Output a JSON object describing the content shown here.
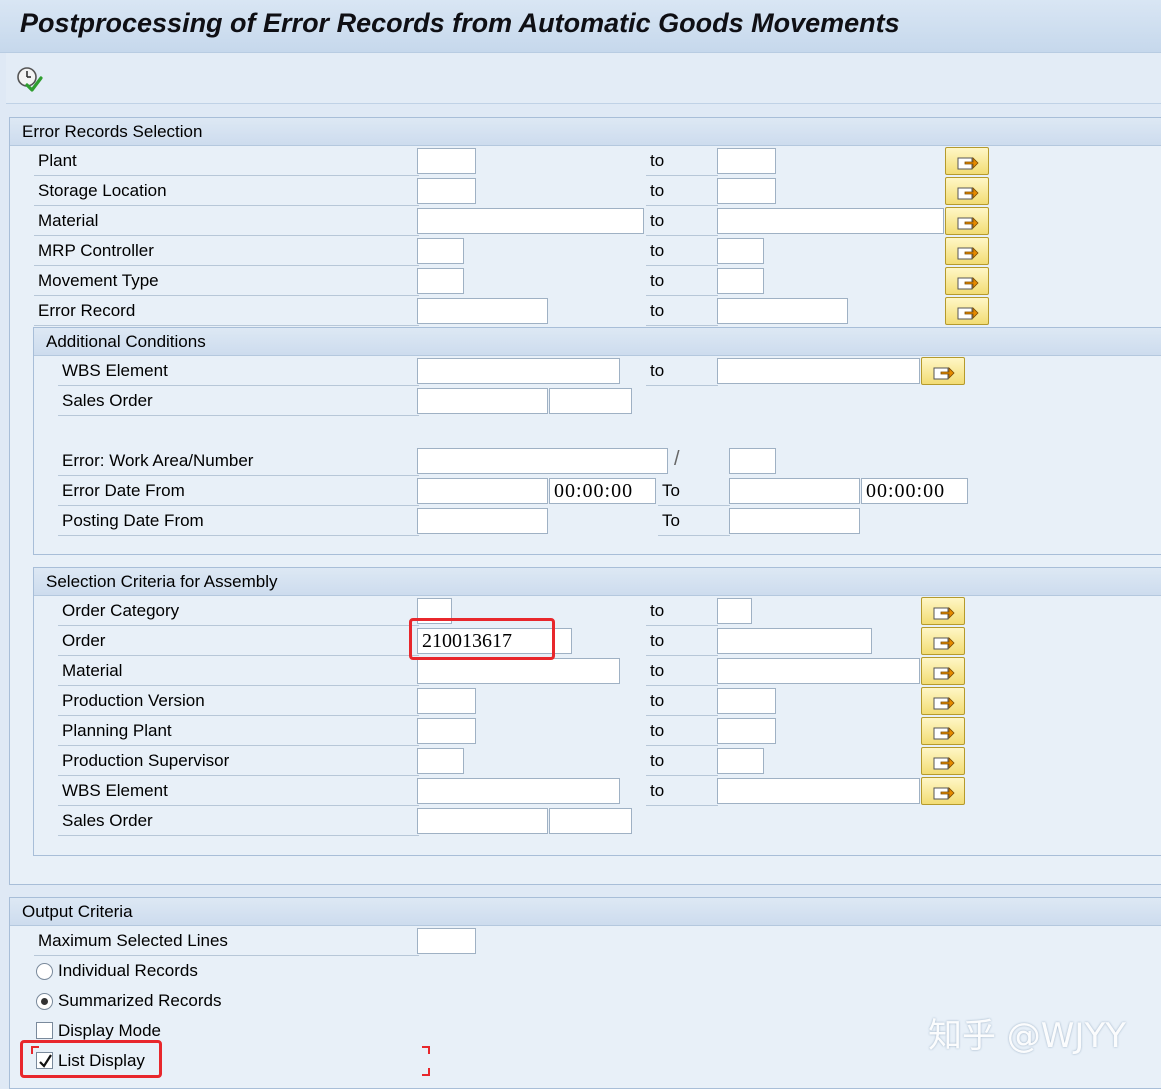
{
  "window": {
    "title": "Postprocessing of Error Records from Automatic Goods Movements"
  },
  "toolbar": {
    "execute_icon": "clock-check-icon"
  },
  "error_records_selection": {
    "header": "Error Records Selection",
    "to_label": "to",
    "rows": [
      {
        "label": "Plant",
        "from": "",
        "to": ""
      },
      {
        "label": "Storage Location",
        "from": "",
        "to": ""
      },
      {
        "label": "Material",
        "from": "",
        "to": ""
      },
      {
        "label": "MRP Controller",
        "from": "",
        "to": ""
      },
      {
        "label": "Movement Type",
        "from": "",
        "to": ""
      },
      {
        "label": "Error Record",
        "from": "",
        "to": ""
      }
    ]
  },
  "additional_conditions": {
    "header": "Additional Conditions",
    "to_label": "to",
    "wbs_element": {
      "label": "WBS Element",
      "from": "",
      "to": ""
    },
    "sales_order": {
      "label": "Sales Order",
      "order": "",
      "item": ""
    },
    "error_work_area": {
      "label": "Error: Work Area/Number",
      "area": "",
      "separator": "/",
      "number": ""
    },
    "error_date": {
      "label": "Error Date From",
      "from_date": "",
      "from_time": "00:00:00",
      "to_label": "To",
      "to_date": "",
      "to_time": "00:00:00"
    },
    "posting_date": {
      "label": "Posting Date From",
      "from": "",
      "to_label": "To",
      "to": ""
    }
  },
  "assembly_criteria": {
    "header": "Selection Criteria for Assembly",
    "to_label": "to",
    "rows": [
      {
        "label": "Order Category",
        "from": "",
        "to": ""
      },
      {
        "label": "Order",
        "from": "210013617",
        "to": ""
      },
      {
        "label": "Material",
        "from": "",
        "to": ""
      },
      {
        "label": "Production Version",
        "from": "",
        "to": ""
      },
      {
        "label": "Planning Plant",
        "from": "",
        "to": ""
      },
      {
        "label": "Production Supervisor",
        "from": "",
        "to": ""
      },
      {
        "label": "WBS Element",
        "from": "",
        "to": ""
      }
    ],
    "sales_order": {
      "label": "Sales Order",
      "order": "",
      "item": ""
    }
  },
  "output_criteria": {
    "header": "Output Criteria",
    "max_lines": {
      "label": "Maximum Selected Lines",
      "value": ""
    },
    "individual_records": {
      "label": "Individual Records",
      "selected": false
    },
    "summarized_records": {
      "label": "Summarized Records",
      "selected": true
    },
    "display_mode": {
      "label": "Display Mode",
      "checked": false
    },
    "list_display": {
      "label": "List Display",
      "checked": true
    }
  },
  "watermark": "知乎 @WJYY",
  "colors": {
    "highlight": "#e8272c",
    "button_yellow": "#f2dc74",
    "frame_bg": "#e8f0f8"
  }
}
